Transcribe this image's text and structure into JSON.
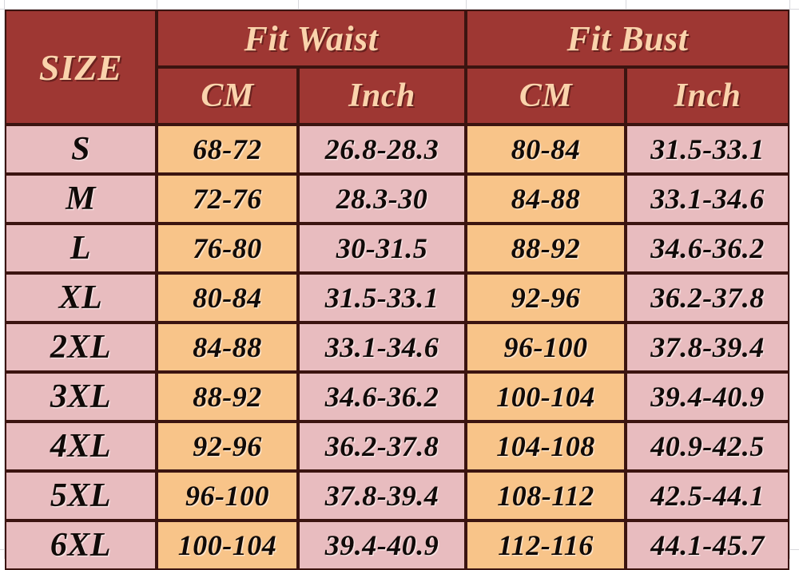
{
  "table": {
    "header": {
      "size_label": "SIZE",
      "groups": [
        {
          "label": "Fit Waist",
          "sub": [
            "CM",
            "Inch"
          ]
        },
        {
          "label": "Fit Bust",
          "sub": [
            "CM",
            "Inch"
          ]
        }
      ]
    },
    "columns": [
      "SIZE",
      "Fit Waist CM",
      "Fit Waist Inch",
      "Fit Bust CM",
      "Fit Bust Inch"
    ],
    "rows": [
      {
        "size": "S",
        "waist_cm": "68-72",
        "waist_in": "26.8-28.3",
        "bust_cm": "80-84",
        "bust_in": "31.5-33.1"
      },
      {
        "size": "M",
        "waist_cm": "72-76",
        "waist_in": "28.3-30",
        "bust_cm": "84-88",
        "bust_in": "33.1-34.6"
      },
      {
        "size": "L",
        "waist_cm": "76-80",
        "waist_in": "30-31.5",
        "bust_cm": "88-92",
        "bust_in": "34.6-36.2"
      },
      {
        "size": "XL",
        "waist_cm": "80-84",
        "waist_in": "31.5-33.1",
        "bust_cm": "92-96",
        "bust_in": "36.2-37.8"
      },
      {
        "size": "2XL",
        "waist_cm": "84-88",
        "waist_in": "33.1-34.6",
        "bust_cm": "96-100",
        "bust_in": "37.8-39.4"
      },
      {
        "size": "3XL",
        "waist_cm": "88-92",
        "waist_in": "34.6-36.2",
        "bust_cm": "100-104",
        "bust_in": "39.4-40.9"
      },
      {
        "size": "4XL",
        "waist_cm": "92-96",
        "waist_in": "36.2-37.8",
        "bust_cm": "104-108",
        "bust_in": "40.9-42.5"
      },
      {
        "size": "5XL",
        "waist_cm": "96-100",
        "waist_in": "37.8-39.4",
        "bust_cm": "108-112",
        "bust_in": "42.5-44.1"
      },
      {
        "size": "6XL",
        "waist_cm": "100-104",
        "waist_in": "39.4-40.9",
        "bust_cm": "112-116",
        "bust_in": "44.1-45.7"
      }
    ]
  },
  "colors": {
    "header_bg": "#9e3733",
    "header_text": "#fad3ac",
    "cell_pink": "#e8bcbf",
    "cell_orange": "#f8c489",
    "border": "#3b1410",
    "gridline": "#d8d8dc"
  }
}
